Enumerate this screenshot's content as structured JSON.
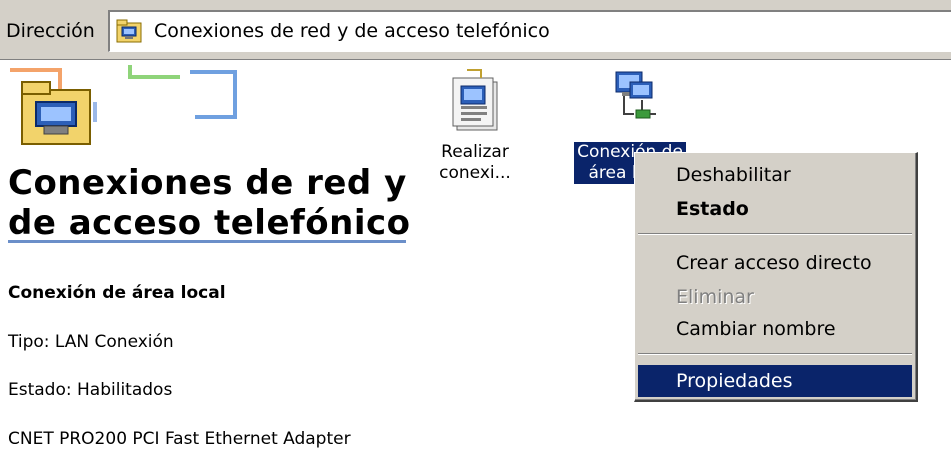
{
  "address_bar": {
    "label": "Dirección",
    "value": "Conexiones de red y de acceso telefónico",
    "icon": "network-folder-icon"
  },
  "panel": {
    "title": "Conexiones de red y\nde acceso telefónico",
    "connection_name": "Conexión de área local",
    "type": "Tipo: LAN Conexión",
    "status": "Estado: Habilitados",
    "adapter": "CNET PRO200 PCI Fast Ethernet Adapter"
  },
  "icons": [
    {
      "label": "Realizar\nconexi...",
      "icon": "make-connection-icon",
      "selected": false
    },
    {
      "label": "Conexión de\nárea local",
      "icon": "lan-connection-icon",
      "selected": true
    }
  ],
  "context_menu": {
    "items": [
      {
        "label": "Deshabilitar",
        "bold": false,
        "disabled": false,
        "highlighted": false
      },
      {
        "label": "Estado",
        "bold": true,
        "disabled": false,
        "highlighted": false
      },
      {
        "label": "Crear acceso directo",
        "bold": false,
        "disabled": false,
        "highlighted": false
      },
      {
        "label": "Eliminar",
        "bold": false,
        "disabled": true,
        "highlighted": false
      },
      {
        "label": "Cambiar nombre",
        "bold": false,
        "disabled": false,
        "highlighted": false
      },
      {
        "label": "Propiedades",
        "bold": false,
        "disabled": false,
        "highlighted": true
      }
    ]
  },
  "colors": {
    "selection": "#0a246a",
    "menu_background": "#d4d0c8",
    "title_rule": "#6b8fc9"
  }
}
